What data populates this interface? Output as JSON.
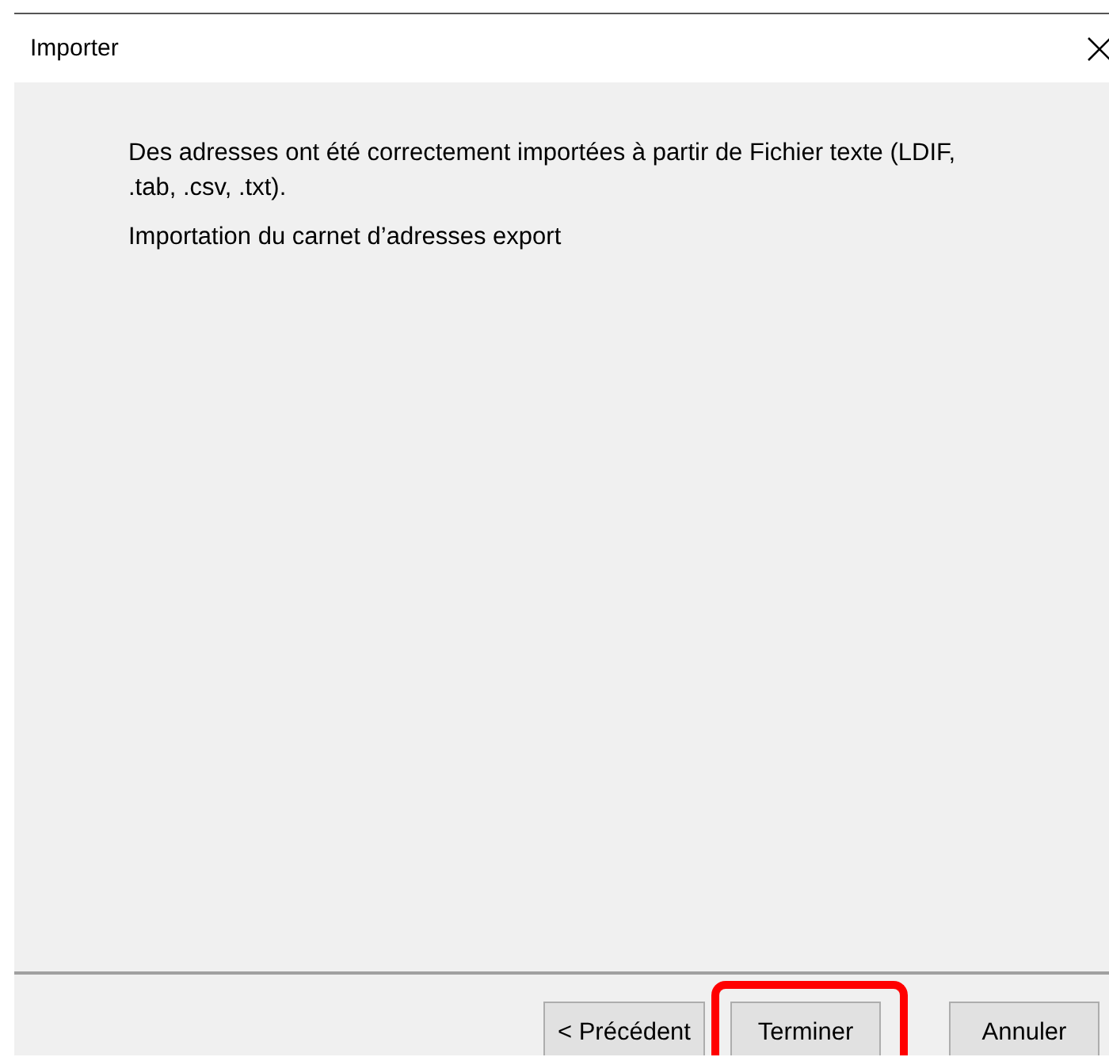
{
  "window": {
    "title": "Importer"
  },
  "message": {
    "lines": [
      "Des adresses ont été correctement importées à partir de Fichier texte (LDIF, .tab, .csv, .txt).",
      "Importation du carnet d’adresses export"
    ]
  },
  "buttons": [
    {
      "label": "< Précédent",
      "highlighted": false
    },
    {
      "label": "Terminer",
      "highlighted": true
    },
    {
      "label": "Annuler",
      "highlighted": false
    }
  ]
}
